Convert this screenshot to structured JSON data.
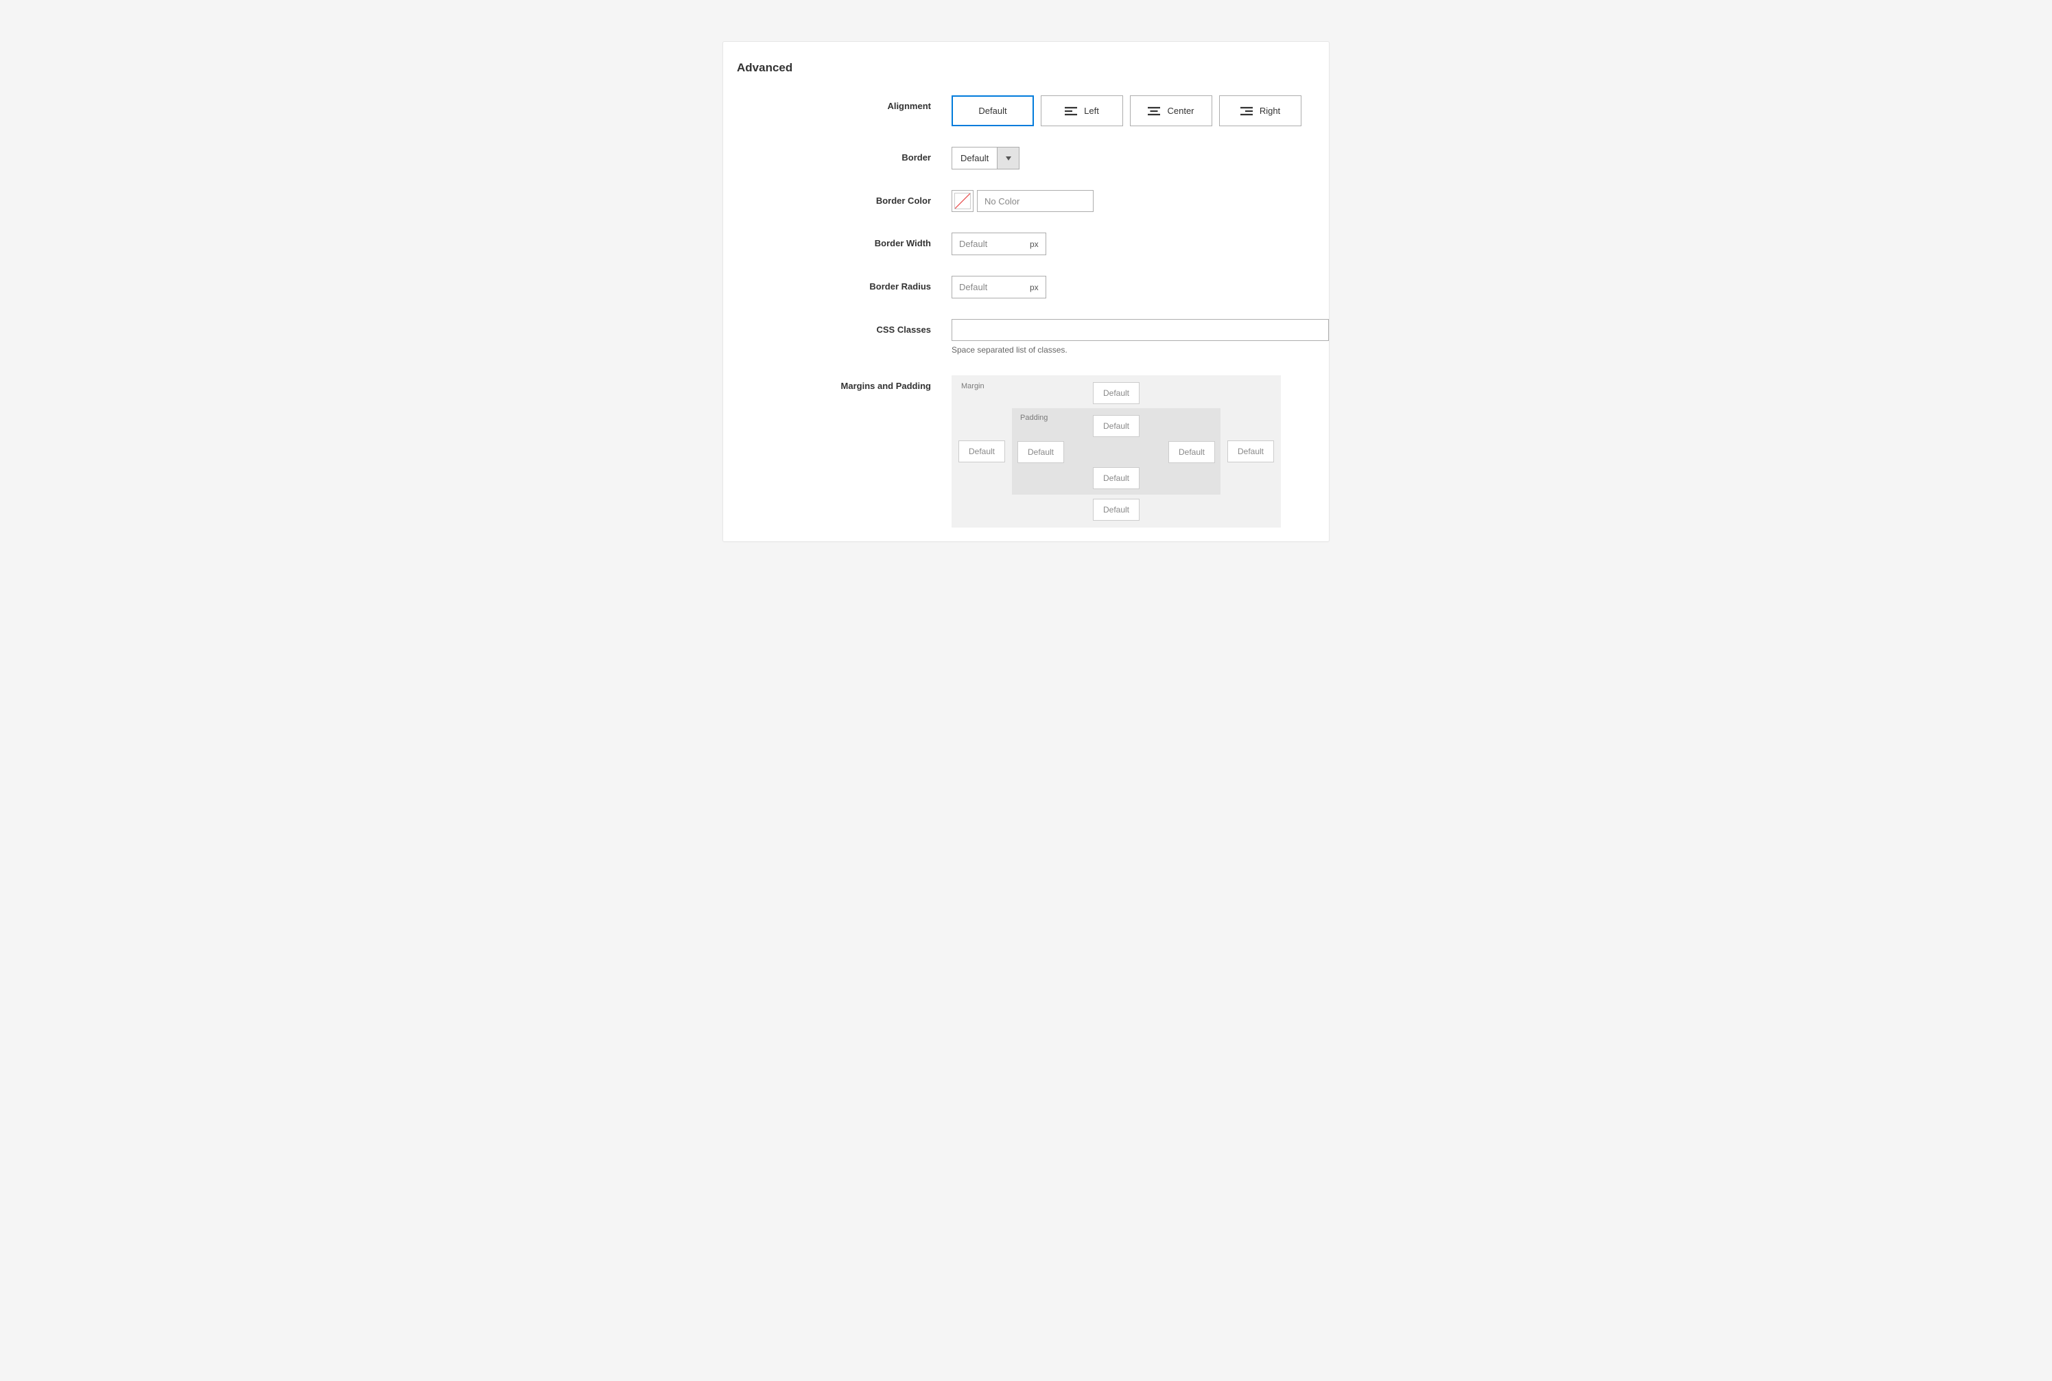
{
  "panel": {
    "title": "Advanced"
  },
  "labels": {
    "alignment": "Alignment",
    "border": "Border",
    "border_color": "Border Color",
    "border_width": "Border Width",
    "border_radius": "Border Radius",
    "css_classes": "CSS Classes",
    "margins_padding": "Margins and Padding"
  },
  "alignment": {
    "options": {
      "default": "Default",
      "left": "Left",
      "center": "Center",
      "right": "Right"
    },
    "selected": "default"
  },
  "border": {
    "value": "Default"
  },
  "border_color": {
    "placeholder": "No Color",
    "value": ""
  },
  "border_width": {
    "placeholder": "Default",
    "suffix": "px",
    "value": ""
  },
  "border_radius": {
    "placeholder": "Default",
    "suffix": "px",
    "value": ""
  },
  "css_classes": {
    "value": "",
    "hint": "Space separated list of classes."
  },
  "box_model": {
    "margin_label": "Margin",
    "padding_label": "Padding",
    "placeholder": "Default",
    "margin": {
      "top": "",
      "right": "",
      "bottom": "",
      "left": ""
    },
    "padding": {
      "top": "",
      "right": "",
      "bottom": "",
      "left": ""
    }
  }
}
